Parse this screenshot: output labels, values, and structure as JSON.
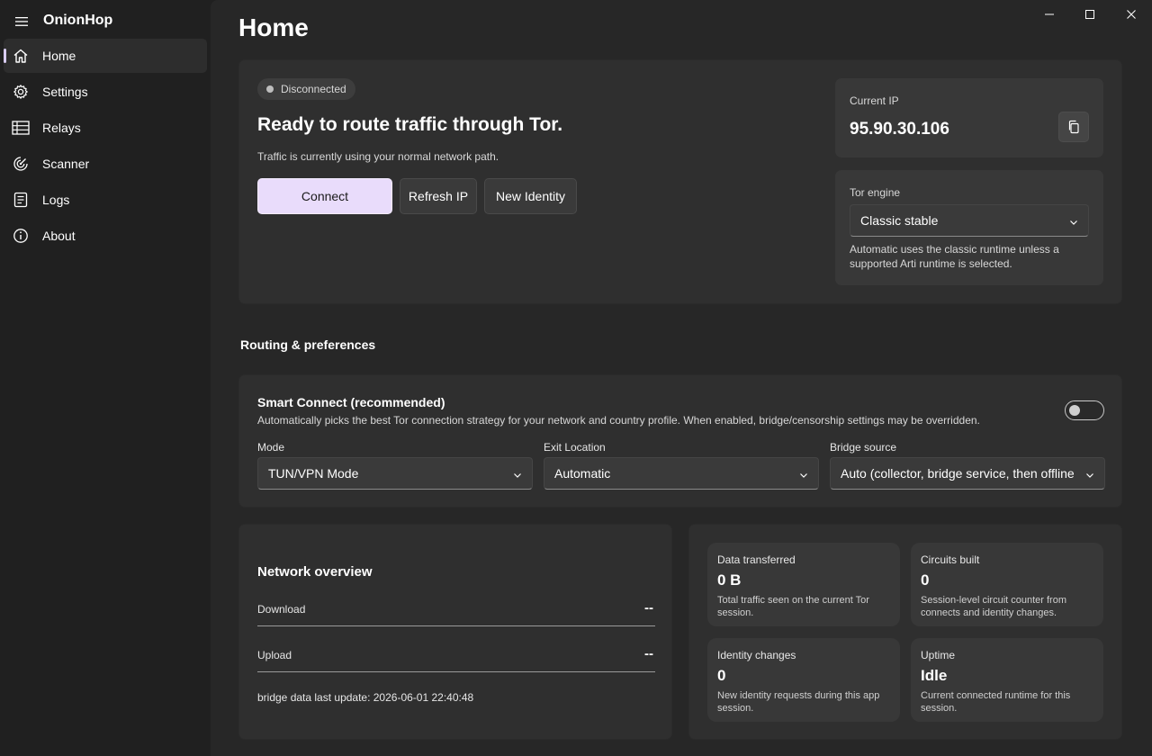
{
  "app": {
    "title": "OnionHop"
  },
  "nav": {
    "items": [
      {
        "label": "Home",
        "icon": "home-icon",
        "active": true
      },
      {
        "label": "Settings",
        "icon": "gear-icon"
      },
      {
        "label": "Relays",
        "icon": "list-icon"
      },
      {
        "label": "Scanner",
        "icon": "radar-icon"
      },
      {
        "label": "Logs",
        "icon": "document-icon"
      },
      {
        "label": "About",
        "icon": "info-icon"
      }
    ]
  },
  "page": {
    "title": "Home"
  },
  "hero": {
    "status": "Disconnected",
    "title": "Ready to route traffic through Tor.",
    "description": "Traffic is currently using your normal network path.",
    "connect_label": "Connect",
    "refresh_label": "Refresh IP",
    "new_identity_label": "New Identity"
  },
  "current_ip": {
    "label": "Current IP",
    "value": "95.90.30.106"
  },
  "tor_engine": {
    "label": "Tor engine",
    "selected": "Classic stable",
    "help": "Automatic uses the classic runtime unless a supported Arti runtime is selected."
  },
  "routing": {
    "section_title": "Routing & preferences",
    "smart_connect_title": "Smart Connect (recommended)",
    "smart_connect_desc": "Automatically picks the best Tor connection strategy for your network and country profile. When enabled, bridge/censorship settings may be overridden.",
    "smart_connect_enabled": false,
    "mode_label": "Mode",
    "mode_value": "TUN/VPN Mode",
    "exit_label": "Exit Location",
    "exit_value": "Automatic",
    "bridge_label": "Bridge source",
    "bridge_value": "Auto (collector, bridge service, then offline"
  },
  "network": {
    "title": "Network overview",
    "download_label": "Download",
    "download_value": "--",
    "upload_label": "Upload",
    "upload_value": "--",
    "bridge_update": "bridge data last update: 2026-06-01 22:40:48"
  },
  "stats": [
    {
      "label": "Data transferred",
      "value": "0 B",
      "desc": "Total traffic seen on the current Tor session."
    },
    {
      "label": "Circuits built",
      "value": "0",
      "desc": "Session-level circuit counter from connects and identity changes."
    },
    {
      "label": "Identity changes",
      "value": "0",
      "desc": "New identity requests during this app session."
    },
    {
      "label": "Uptime",
      "value": "Idle",
      "desc": "Current connected runtime for this session."
    }
  ],
  "colors": {
    "accent": "#e9dcfb",
    "background": "#202020",
    "card": "#2f2f2f"
  }
}
